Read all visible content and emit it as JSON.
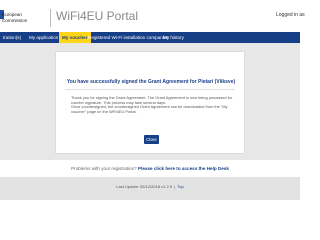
{
  "header": {
    "logo_line1": "European",
    "logo_line2": "Commission",
    "portal_title": "WiFi4EU Portal",
    "logged_in": "Logged in as"
  },
  "nav": {
    "items": [
      {
        "label": "tration(s)",
        "active": false
      },
      {
        "label": "My application",
        "active": false
      },
      {
        "label": "My voucher",
        "active": true
      },
      {
        "label": "Registered Wi-Fi installation companies",
        "active": false
      },
      {
        "label": "My history",
        "active": false
      }
    ]
  },
  "dialog": {
    "title": "You have successfully signed the Grant Agreement for Pietari (Viiksve)",
    "paragraph1": "Thank you for signing the Grant Agreement. The Grant Agreement is now being processed for counter signature. This process may take several days.",
    "paragraph2": "Once countersigned, the countersigned Grant Agreement can be downloaded from the \"My voucher\" page on the WiFi4EU Portal.",
    "close_label": "Close"
  },
  "help": {
    "text": "Problems with your registration? ",
    "link": "Please click here to access the Help Desk"
  },
  "footer": {
    "last_update": "Last Update: 05/12/2018 v1.2.9",
    "separator": "|",
    "top_link": "Top"
  },
  "colors": {
    "nav_blue": "#173f88",
    "active_tab_yellow": "#ffd617",
    "main_background": "#e7e7e7"
  }
}
